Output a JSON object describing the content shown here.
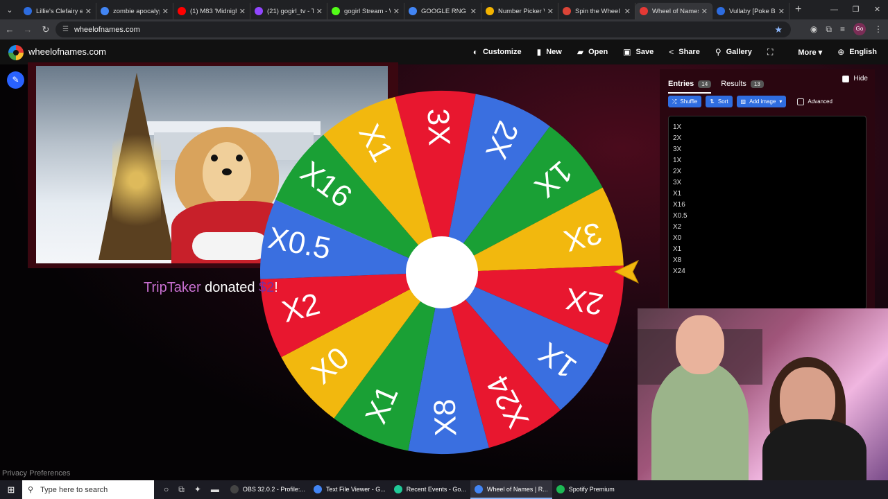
{
  "browser": {
    "tabs": [
      {
        "label": "Lillie's Clefairy ex",
        "color": "#2d6cdf"
      },
      {
        "label": "zombie apocalyp",
        "color": "#4285f4"
      },
      {
        "label": "(1) M83 'Midnigh",
        "color": "#ff0000"
      },
      {
        "label": "(21) gogirl_tv - Tw",
        "color": "#9146ff"
      },
      {
        "label": "gogirl Stream - W",
        "color": "#53fc18"
      },
      {
        "label": "GOOGLE RNG - G",
        "color": "#4285f4"
      },
      {
        "label": "Number Picker W",
        "color": "#f4b400"
      },
      {
        "label": "Spin the Wheel -",
        "color": "#db4437"
      },
      {
        "label": "Wheel of Names |",
        "color": "#e53935"
      },
      {
        "label": "Vullaby [Poke Bal",
        "color": "#2d6cdf"
      }
    ],
    "url": "wheelofnames.com",
    "profile_initials": "Go"
  },
  "app": {
    "brand": "wheelofnames.com",
    "menu": [
      {
        "label": "Customize",
        "icon": "◐"
      },
      {
        "label": "New",
        "icon": "▮"
      },
      {
        "label": "Open",
        "icon": "▰"
      },
      {
        "label": "Save",
        "icon": "▣"
      },
      {
        "label": "Share",
        "icon": "<"
      },
      {
        "label": "Gallery",
        "icon": "⚲"
      },
      {
        "label": "",
        "icon": "⛶"
      },
      {
        "label": "More ▾",
        "icon": ""
      },
      {
        "label": "English",
        "icon": "⊕"
      }
    ]
  },
  "overlay": {
    "donor": "TripTaker",
    "donated_text": " donated ",
    "amount": "$2",
    "exclaim": "!"
  },
  "wheel": {
    "segments": [
      {
        "label": "3X",
        "color": "#e8172f"
      },
      {
        "label": "2X",
        "color": "#3a6fe0"
      },
      {
        "label": "1X",
        "color": "#1aa035"
      },
      {
        "label": "3X",
        "color": "#f2b80e"
      },
      {
        "label": "2X",
        "color": "#e8172f"
      },
      {
        "label": "1X",
        "color": "#3a6fe0"
      },
      {
        "label": "X24",
        "color": "#e8172f"
      },
      {
        "label": "X8",
        "color": "#3a6fe0"
      },
      {
        "label": "X1",
        "color": "#1aa035"
      },
      {
        "label": "X0",
        "color": "#f2b80e"
      },
      {
        "label": "X2",
        "color": "#e8172f"
      },
      {
        "label": "X0.5",
        "color": "#3a6fe0"
      },
      {
        "label": "X16",
        "color": "#1aa035"
      },
      {
        "label": "X1",
        "color": "#f2b80e"
      }
    ],
    "pointer_color": "#f2b80e"
  },
  "panel": {
    "tabs": [
      {
        "label": "Entries",
        "count": "14"
      },
      {
        "label": "Results",
        "count": "13"
      }
    ],
    "hide_label": "Hide",
    "buttons": {
      "shuffle": "Shuffle",
      "sort": "Sort",
      "add_image": "Add image"
    },
    "advanced_label": "Advanced",
    "entries": [
      "1X",
      "2X",
      "3X",
      "1X",
      "2X",
      "3X",
      "X1",
      "X16",
      "X0.5",
      "X2",
      "X0",
      "X1",
      "X8",
      "X24"
    ]
  },
  "footer": {
    "privacy": "Privacy Preferences"
  },
  "taskbar": {
    "search_placeholder": "Type here to search",
    "apps": [
      {
        "label": "OBS 32.0.2 - Profile:...",
        "color": "#444"
      },
      {
        "label": "Text File Viewer - G...",
        "color": "#4285f4"
      },
      {
        "label": "Recent Events - Go...",
        "color": "#20c997"
      },
      {
        "label": "Wheel of Names | R...",
        "color": "#4285f4"
      },
      {
        "label": "Spotify Premium",
        "color": "#1db954"
      }
    ]
  }
}
